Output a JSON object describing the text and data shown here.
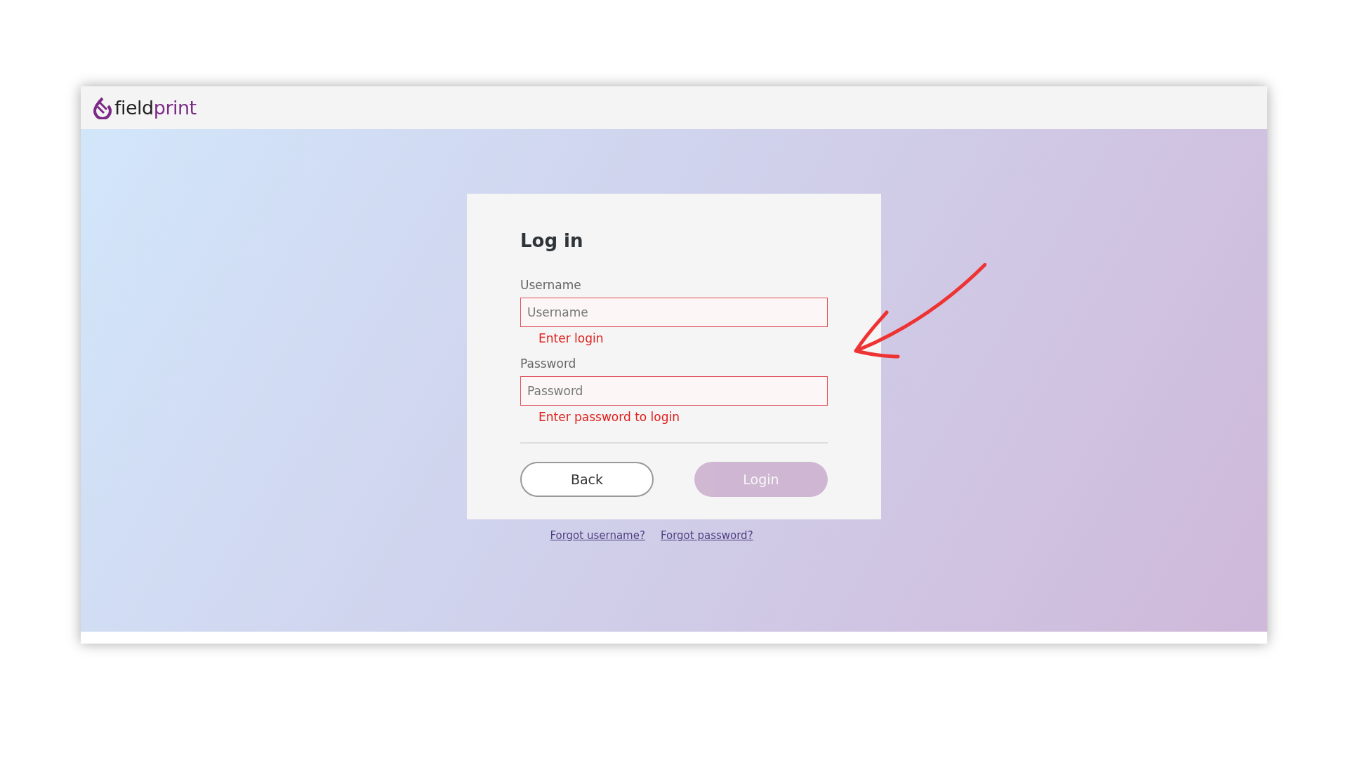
{
  "header": {
    "logo": {
      "text_dark": "field",
      "text_accent": "print"
    }
  },
  "login_card": {
    "title": "Log in",
    "fields": [
      {
        "label": "Username",
        "placeholder": "Username",
        "error": true,
        "error_message": "Enter login"
      },
      {
        "label": "Password",
        "placeholder": "Password",
        "error": true,
        "error_message": "Enter password to login"
      }
    ],
    "buttons": [
      {
        "kind": "secondary",
        "label": "Back",
        "disabled": false
      },
      {
        "kind": "primary",
        "label": "Login",
        "disabled": true
      }
    ]
  },
  "links": [
    "Forgot username?",
    "Forgot password?"
  ]
}
